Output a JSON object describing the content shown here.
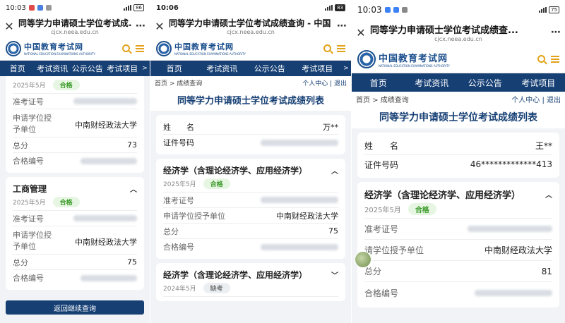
{
  "panels": [
    {
      "status": {
        "time": "10:03",
        "battery": "86"
      },
      "title": "同等学力申请硕士学位考试成...",
      "url": "cjcx.neea.edu.cn",
      "nav": [
        "首页",
        "考试资讯",
        "公示公告",
        "考试项目"
      ],
      "top_partial": {
        "date": "2025年5月",
        "badge": "合格"
      },
      "top_rows": [
        {
          "label": "准考证号",
          "value": ""
        },
        {
          "label": "申请学位授予单位",
          "value": "中南财经政法大学"
        },
        {
          "label": "总分",
          "value": "73"
        },
        {
          "label": "合格编号",
          "value": ""
        }
      ],
      "section": {
        "title": "工商管理",
        "date": "2025年5月",
        "badge": "合格"
      },
      "rows": [
        {
          "label": "准考证号",
          "value": ""
        },
        {
          "label": "申请学位授予单位",
          "value": "中南财经政法大学"
        },
        {
          "label": "总分",
          "value": "75"
        },
        {
          "label": "合格编号",
          "value": ""
        }
      ],
      "back_button": "返回继续查询"
    },
    {
      "status": {
        "time": "10:06",
        "battery": "83"
      },
      "title": "同等学力申请硕士学位考试成绩查询 - 中国",
      "url": "cjcx.neea.edu.cn",
      "nav": [
        "首页",
        "考试资讯",
        "公示公告",
        "考试项目"
      ],
      "breadcrumb": "首页 > 成绩查询",
      "user": "个人中心 | 退出",
      "page_title": "同等学力申请硕士学位考试成绩列表",
      "person": {
        "name_label": "姓　　名",
        "name": "万**",
        "id_label": "证件号码",
        "id": ""
      },
      "section": {
        "title": "经济学（含理论经济学、应用经济学）",
        "date": "2025年5月",
        "badge": "合格"
      },
      "rows": [
        {
          "label": "准考证号",
          "value": ""
        },
        {
          "label": "申请学位授予单位",
          "value": "中南财经政法大学"
        },
        {
          "label": "总分",
          "value": "75"
        },
        {
          "label": "合格编号",
          "value": ""
        }
      ],
      "section2": {
        "title": "经济学（含理论经济学、应用经济学）",
        "date": "2024年5月",
        "badge": "缺考"
      }
    },
    {
      "status": {
        "time": "10:03",
        "battery": "75"
      },
      "title": "同等学力申请硕士学位考试成绩查...",
      "url": "cjcx.neea.edu.cn",
      "nav": [
        "首页",
        "考试资讯",
        "公示公告",
        "考试项目"
      ],
      "breadcrumb": "首页 > 成绩查询",
      "user": "个人中心 | 退出",
      "page_title": "同等学力申请硕士学位考试成绩列表",
      "person": {
        "name_label": "姓　　名",
        "name": "王**",
        "id_label": "证件号码",
        "id": "46*************413"
      },
      "section": {
        "title": "经济学（含理论经济学、应用经济学）",
        "date": "2025年5月",
        "badge": "合格"
      },
      "rows": [
        {
          "label": "准考证号",
          "value": ""
        },
        {
          "label": "请学位授予单位",
          "value": "中南财经政法大学"
        },
        {
          "label": "总分",
          "value": "81"
        },
        {
          "label": "合格编号",
          "value": ""
        }
      ]
    }
  ],
  "logo": {
    "cn": "中国教育考试网",
    "en": "NATIONAL EDUCATION EXAMINATIONS AUTHORITY"
  },
  "colors": {
    "nav": "#163f74",
    "accent": "#e3a21a",
    "pass": "#3a9a2a"
  }
}
